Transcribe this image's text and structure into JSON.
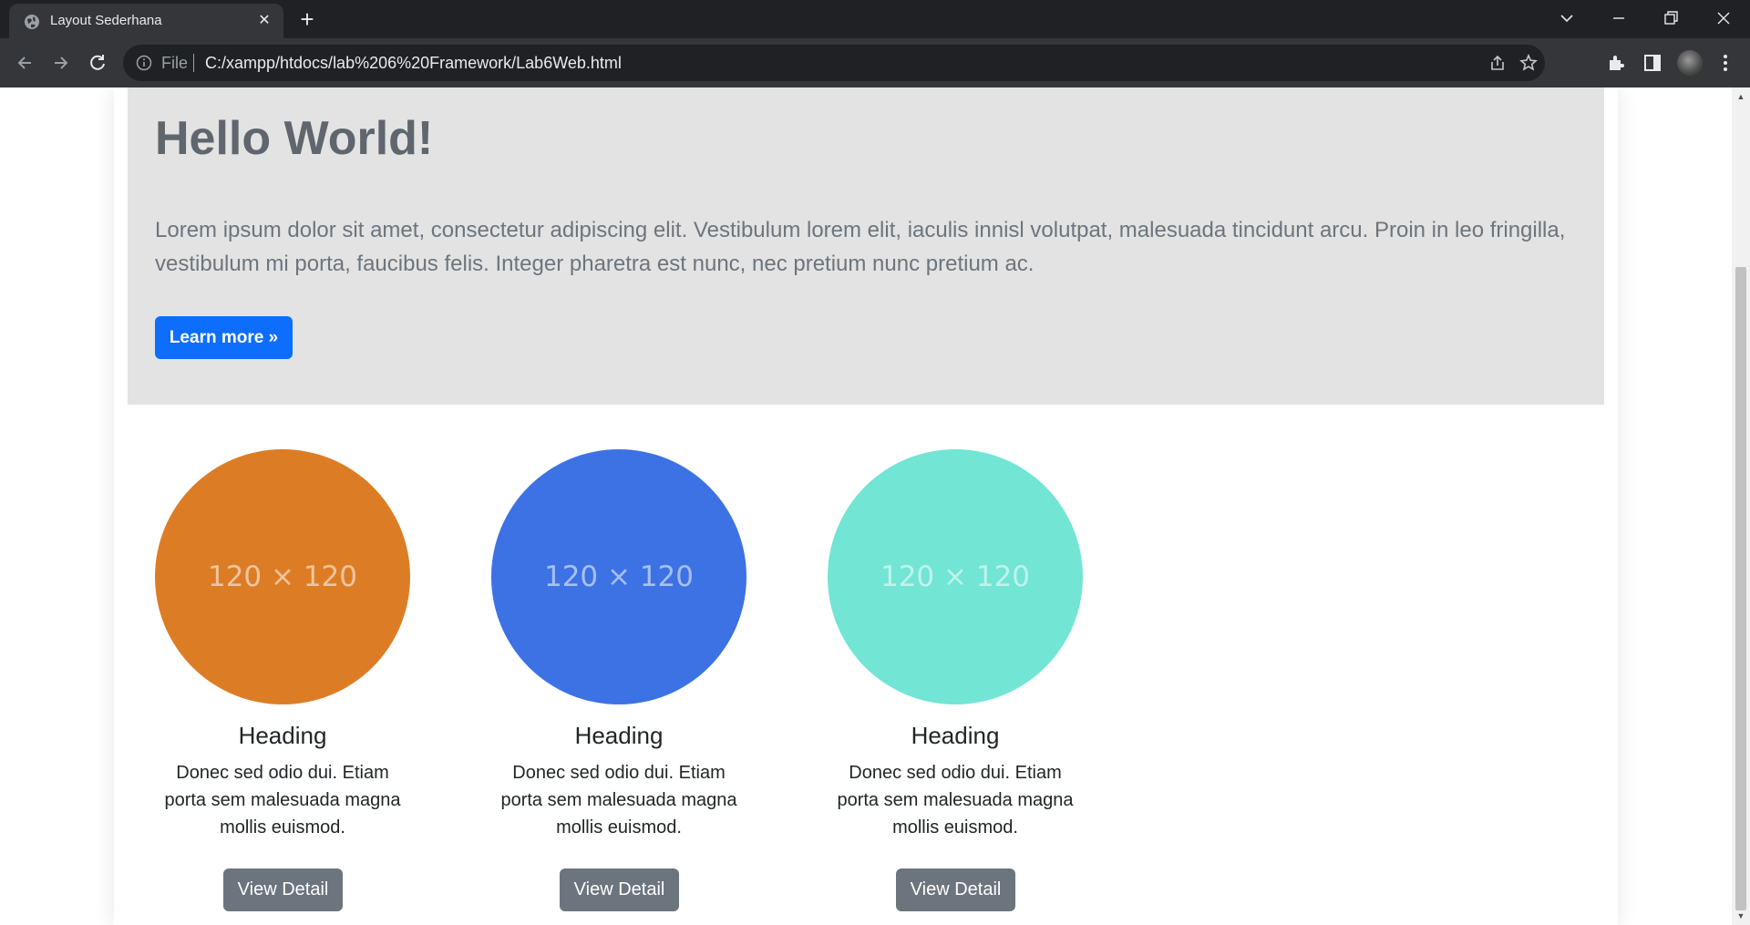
{
  "browser": {
    "tab_title": "Layout Sederhana",
    "file_label": "File",
    "url": "C:/xampp/htdocs/lab%206%20Framework/Lab6Web.html"
  },
  "jumbotron": {
    "title": "Hello World!",
    "text": "Lorem ipsum dolor sit amet, consectetur adipiscing elit. Vestibulum lorem elit, iaculis innisl volutpat, malesuada tincidunt arcu. Proin in leo fringilla, vestibulum mi porta, faucibus felis. Integer pharetra est nunc, nec pretium nunc pretium ac.",
    "button_label": "Learn more »"
  },
  "features": [
    {
      "image_label": "120 × 120",
      "color": "#dc7d26",
      "heading": "Heading",
      "text": "Donec sed odio dui. Etiam porta sem malesuada magna mollis euismod.",
      "button_label": "View Detail"
    },
    {
      "image_label": "120 × 120",
      "color": "#3d72e4",
      "heading": "Heading",
      "text": "Donec sed odio dui. Etiam porta sem malesuada magna mollis euismod.",
      "button_label": "View Detail"
    },
    {
      "image_label": "120 × 120",
      "color": "#72e5d5",
      "heading": "Heading",
      "text": "Donec sed odio dui. Etiam porta sem malesuada magna mollis euismod.",
      "button_label": "View Detail"
    }
  ],
  "colors": {
    "primary": "#0d6efd",
    "secondary": "#6c757d",
    "jumbotron_bg": "#e3e3e3"
  }
}
